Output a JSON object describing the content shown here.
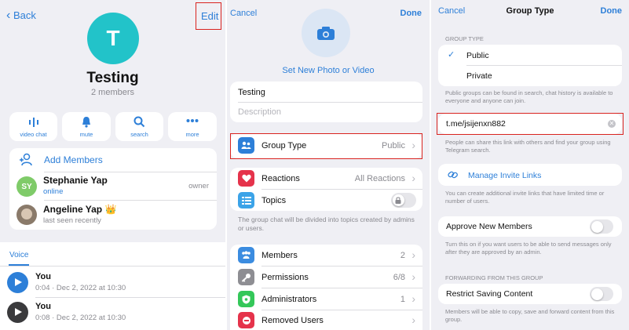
{
  "panel1": {
    "back_label": "Back",
    "edit_label": "Edit",
    "avatar_letter": "T",
    "group_name": "Testing",
    "members_count": "2 members",
    "actions": [
      {
        "label": "video chat",
        "icon": "video-chat-icon"
      },
      {
        "label": "mute",
        "icon": "bell-icon"
      },
      {
        "label": "search",
        "icon": "search-icon"
      },
      {
        "label": "more",
        "icon": "more-icon"
      }
    ],
    "add_members_label": "Add Members",
    "members": [
      {
        "name": "Stephanie Yap",
        "status": "online",
        "role": "owner",
        "initials": "SY"
      },
      {
        "name": "Angeline Yap 👑",
        "status": "last seen recently",
        "role": ""
      }
    ],
    "voice_tab": "Voice",
    "voice_items": [
      {
        "sender": "You",
        "meta": "0:04 · Dec 2, 2022 at 10:30"
      },
      {
        "sender": "You",
        "meta": "0:08 · Dec 2, 2022 at 10:30"
      }
    ]
  },
  "panel2": {
    "cancel_label": "Cancel",
    "done_label": "Done",
    "set_photo_label": "Set New Photo or Video",
    "name_value": "Testing",
    "description_placeholder": "Description",
    "group_type_label": "Group Type",
    "group_type_value": "Public",
    "reactions_label": "Reactions",
    "reactions_value": "All Reactions",
    "topics_label": "Topics",
    "topics_caption": "The group chat will be divided into topics created by admins or users.",
    "members_label": "Members",
    "members_value": "2",
    "permissions_label": "Permissions",
    "permissions_value": "6/8",
    "administrators_label": "Administrators",
    "administrators_value": "1",
    "removed_users_label": "Removed Users"
  },
  "panel3": {
    "cancel_label": "Cancel",
    "title": "Group Type",
    "done_label": "Done",
    "section_group_type": "GROUP TYPE",
    "public_label": "Public",
    "private_label": "Private",
    "public_caption": "Public groups can be found in search, chat history is available to everyone and anyone can join.",
    "link_value": "t.me/jsijenxn882",
    "link_caption": "People can share this link with others and find your group using Telegram search.",
    "manage_links_label": "Manage Invite Links",
    "manage_links_caption": "You can create additional invite links that have limited time or number of users.",
    "approve_label": "Approve New Members",
    "approve_caption": "Turn this on if you want users to be able to send messages only after they are approved by an admin.",
    "section_forwarding": "FORWARDING FROM THIS GROUP",
    "restrict_label": "Restrict Saving Content",
    "restrict_caption": "Members will be able to copy, save and forward content from this group."
  },
  "colors": {
    "accent": "#2d7fd8",
    "avatar_teal": "#22c3c9",
    "highlight_red": "#d9231f"
  }
}
